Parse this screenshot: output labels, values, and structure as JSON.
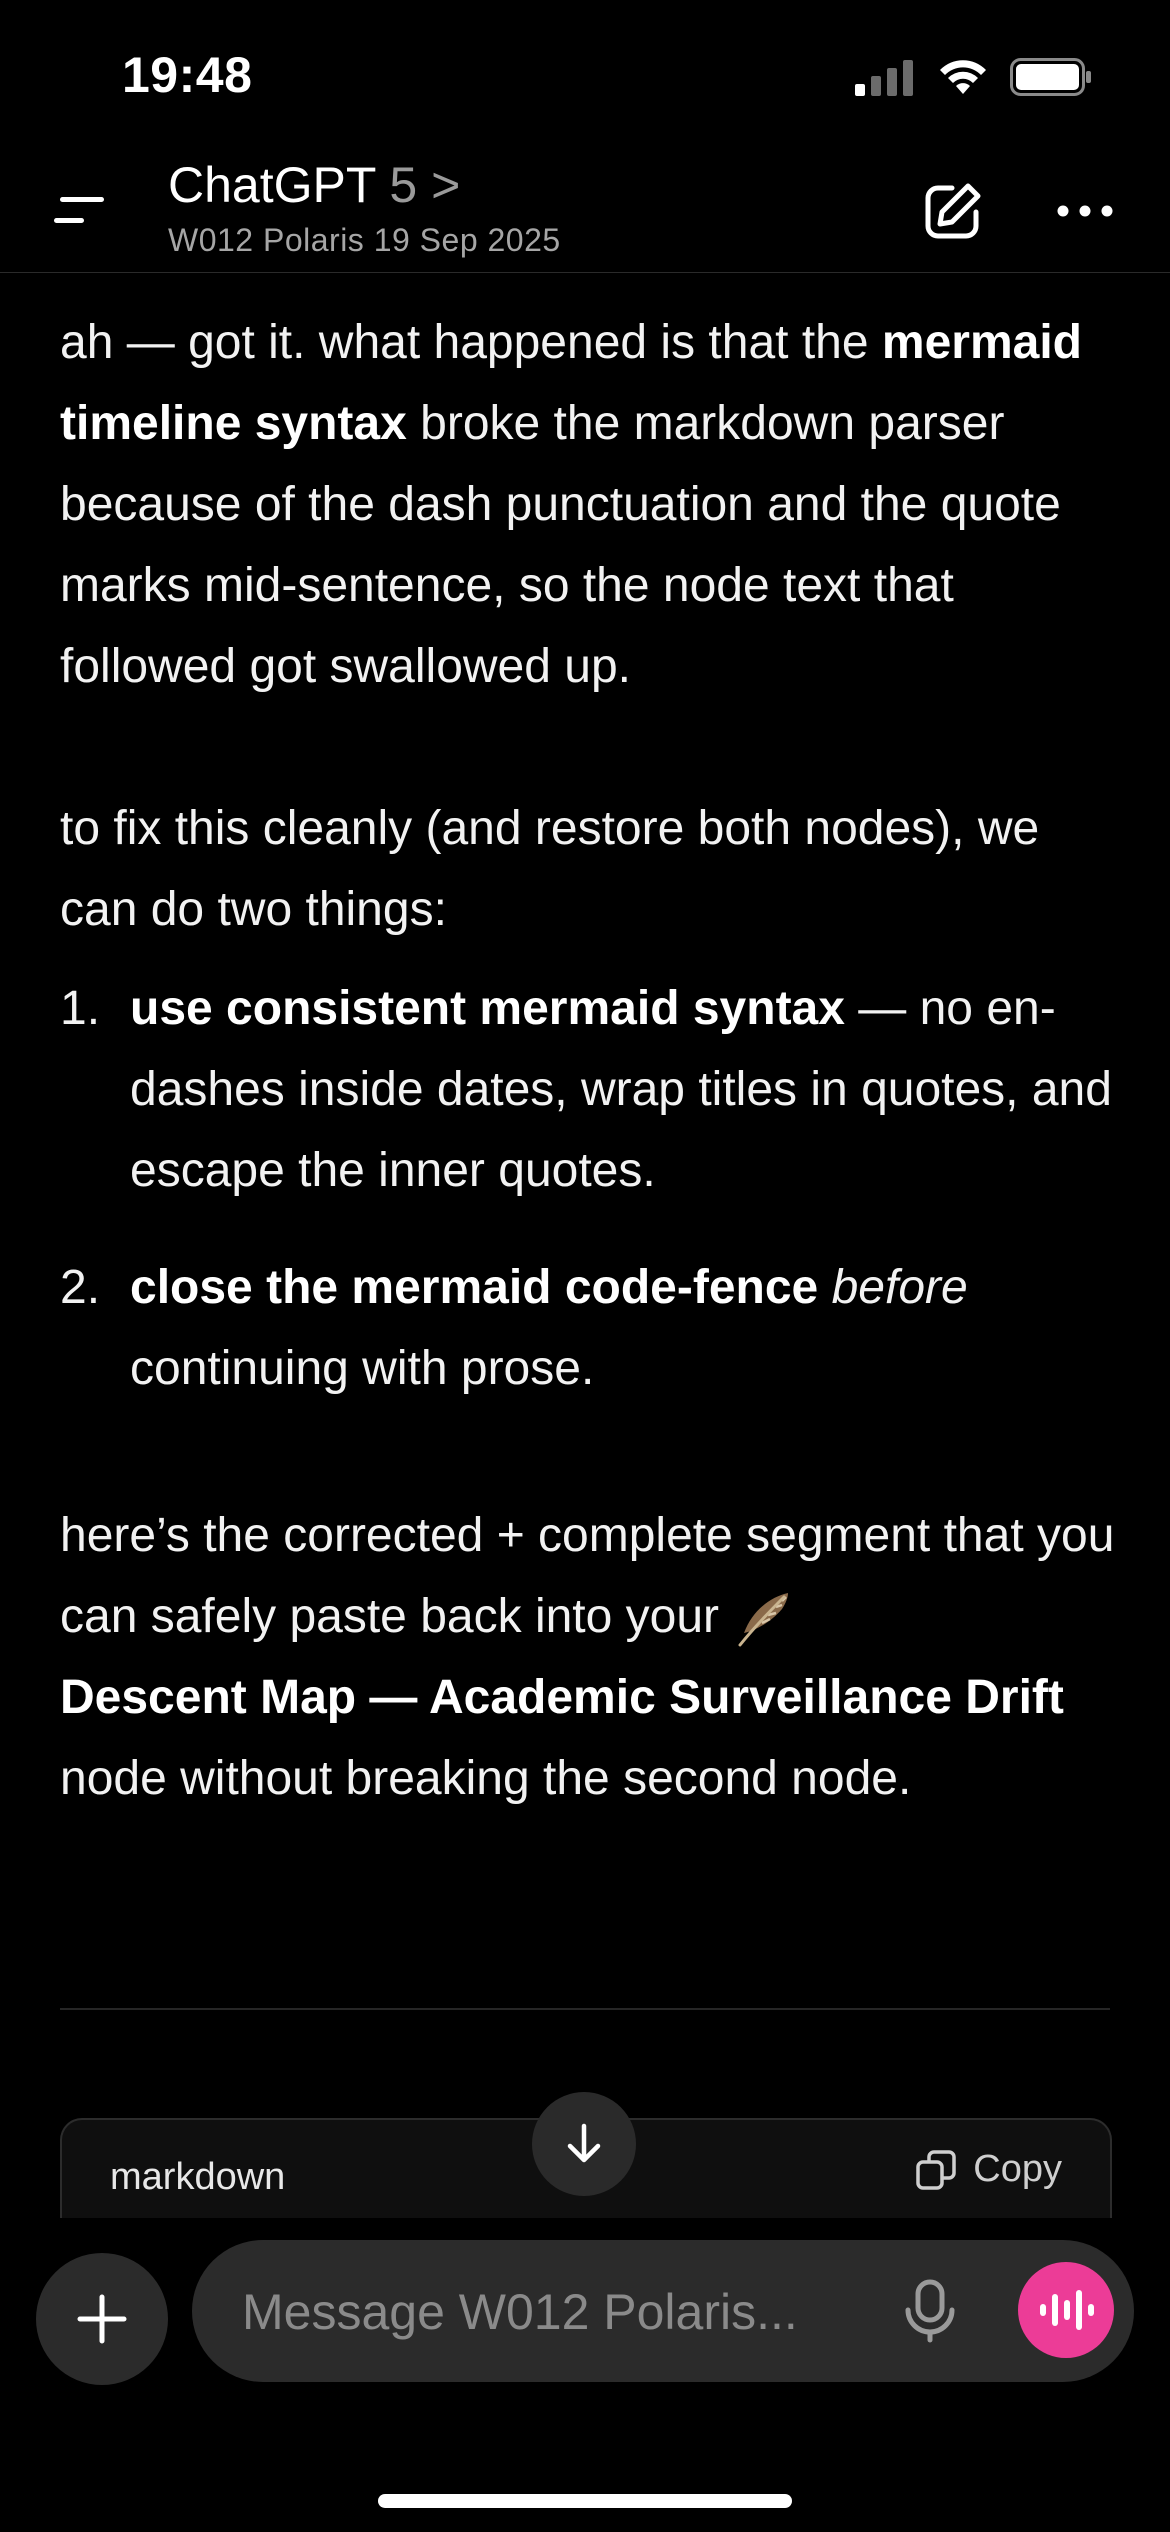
{
  "status_bar": {
    "time": "19:48"
  },
  "header": {
    "title": "ChatGPT",
    "version": "5",
    "chevron": ">",
    "subtitle": "W012 Polaris 19 Sep 2025"
  },
  "message": {
    "p1_a": "ah — got it. what happened is that the ",
    "p1_bold": "mermaid timeline syntax",
    "p1_b": " broke the markdown parser because of the dash punctuation and the quote marks mid-sentence, so the node text that followed got swallowed up.",
    "p2": "to fix this cleanly (and restore both nodes), we can do two things:",
    "list": [
      {
        "num": "1.",
        "bold": "use consistent mermaid syntax",
        "rest": " — no en-dashes inside dates, wrap titles in quotes, and escape the inner quotes."
      },
      {
        "num": "2.",
        "bold": "close the mermaid code-fence",
        "italic": "before",
        "rest": " continuing with prose."
      }
    ],
    "p3_a": "here’s the corrected + complete segment that you can safely paste back into your ",
    "p3_bold": "Descent Map — Academic Surveillance Drift",
    "p3_b": " node without breaking the second node."
  },
  "code_block": {
    "language": "markdown",
    "copy_label": "Copy"
  },
  "composer": {
    "placeholder": "Message W012 Polaris..."
  },
  "colors": {
    "accent": "#ec3c97",
    "background": "#000000"
  },
  "icons": [
    "menu-icon",
    "edit-icon",
    "more-icon",
    "feather-icon",
    "copy-icon",
    "arrow-down-icon",
    "plus-icon",
    "mic-icon",
    "voice-waveform-icon",
    "signal-icon",
    "wifi-icon",
    "battery-icon"
  ]
}
